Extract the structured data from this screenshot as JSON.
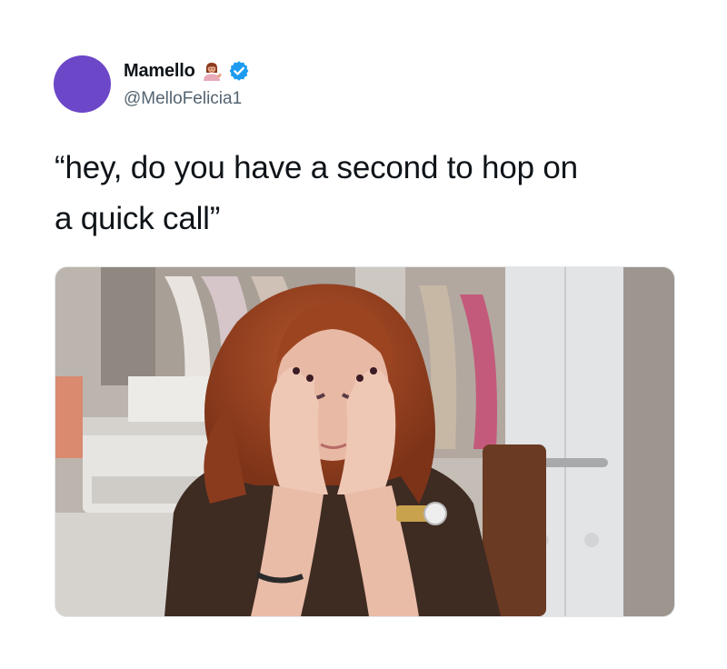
{
  "tweet": {
    "author": {
      "display_name": "Mamello",
      "emoji_icon": "woman-tipping-hand-emoji-icon",
      "verified_icon": "verified-badge-icon",
      "handle": "@MelloFelicia1",
      "avatar_color": "#6c47c8"
    },
    "text": "“hey, do you have a second to hop on\na quick call”",
    "media": {
      "kind": "photo",
      "description_icon": "frustrated-woman-photo"
    }
  },
  "colors": {
    "verified_blue": "#1d9bf0",
    "text_primary": "#0f1419",
    "text_secondary": "#536471"
  }
}
